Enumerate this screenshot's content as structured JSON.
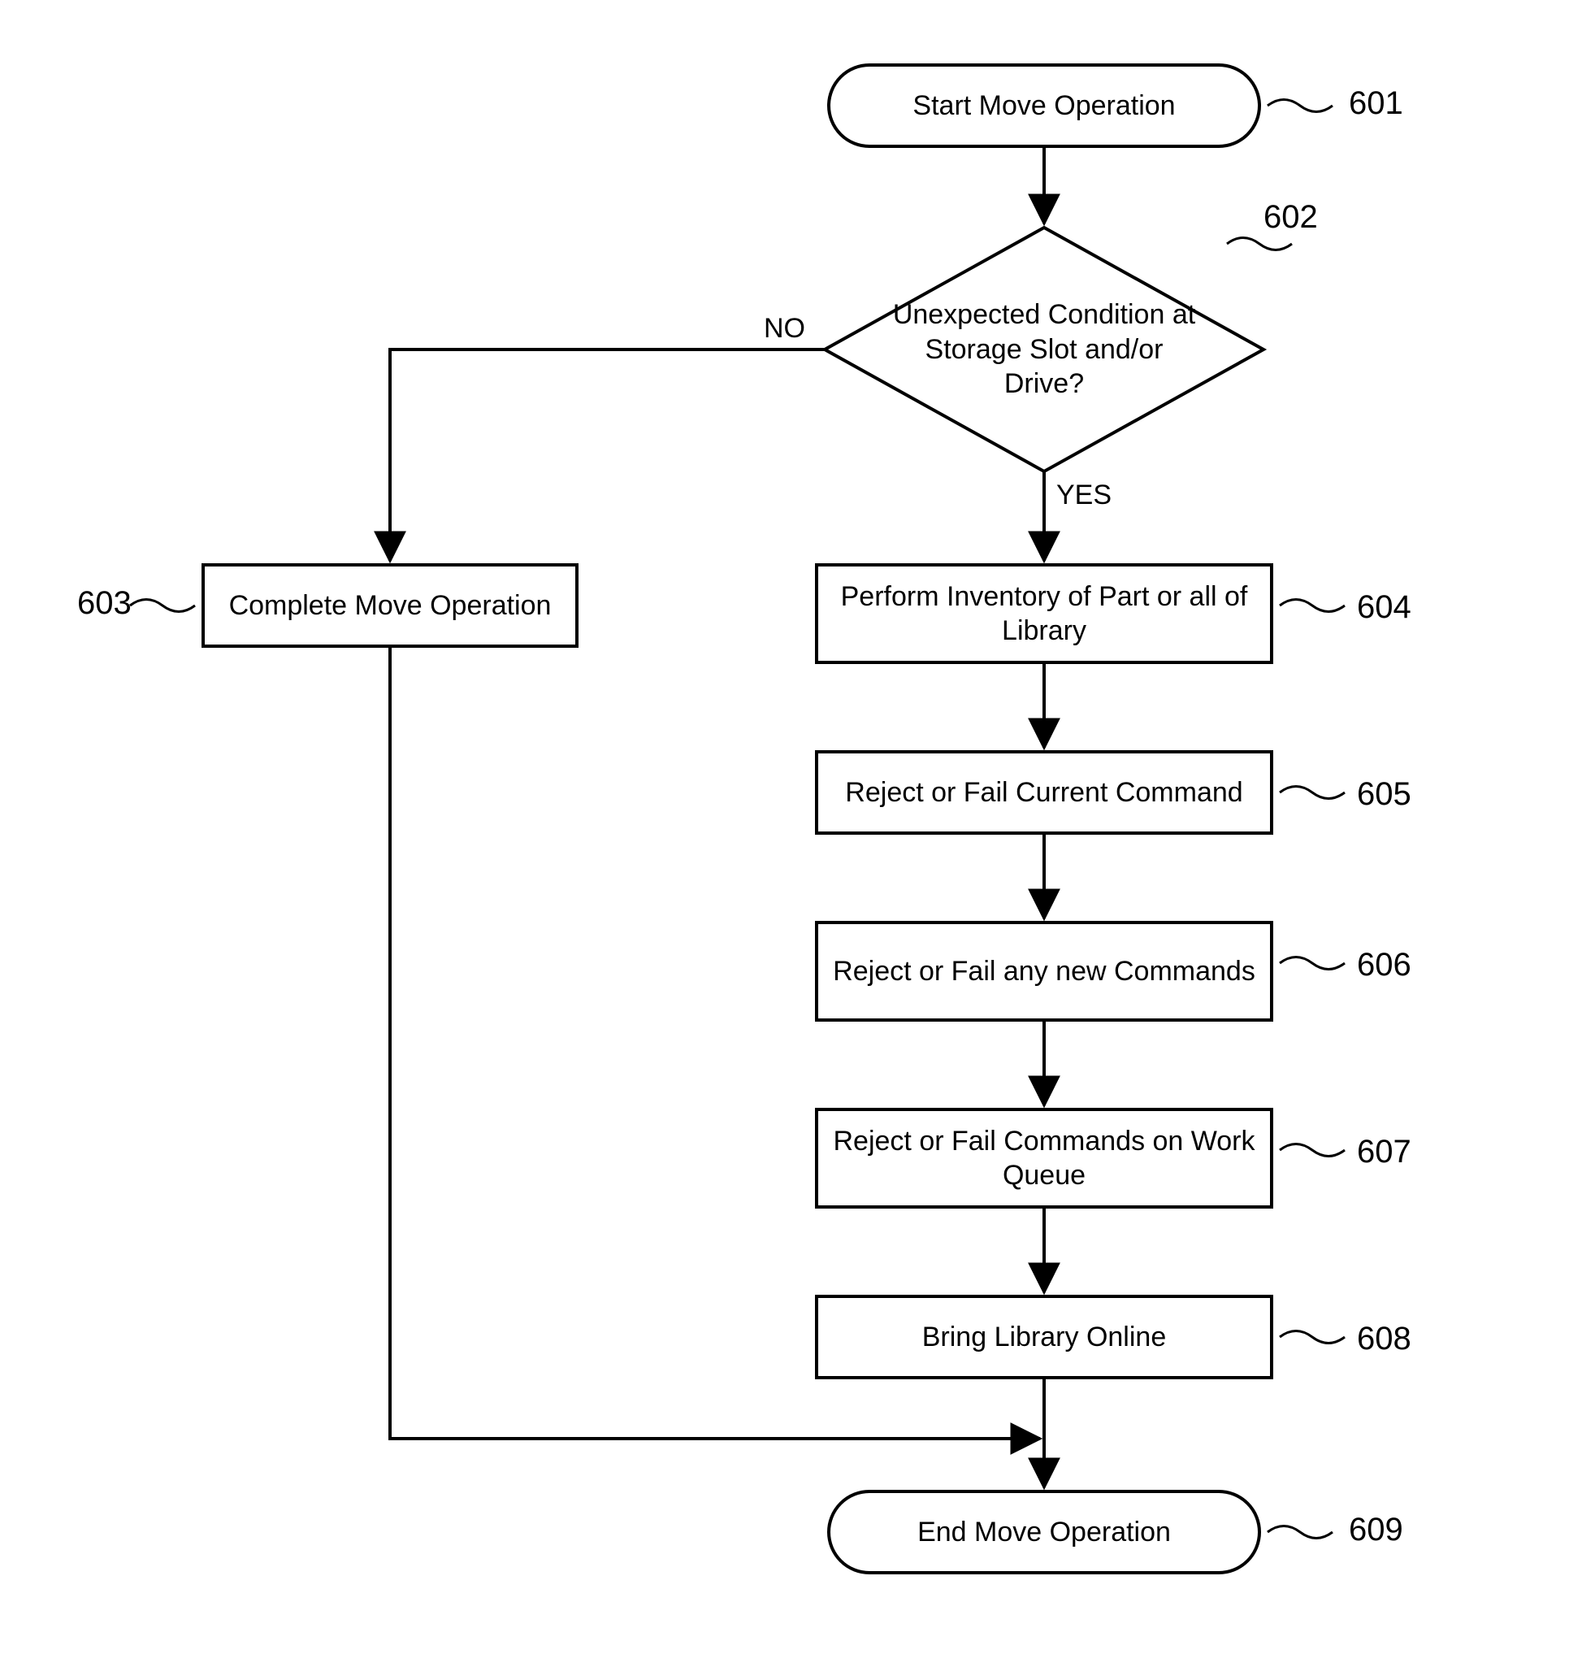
{
  "chart_data": {
    "type": "flowchart",
    "nodes": [
      {
        "id": "601",
        "kind": "terminator",
        "text": "Start Move Operation"
      },
      {
        "id": "602",
        "kind": "decision",
        "text": "Unexpected Condition at Storage Slot and/or Drive?"
      },
      {
        "id": "603",
        "kind": "process",
        "text": "Complete Move Operation"
      },
      {
        "id": "604",
        "kind": "process",
        "text": "Perform Inventory of Part or all of Library"
      },
      {
        "id": "605",
        "kind": "process",
        "text": "Reject or Fail Current Command"
      },
      {
        "id": "606",
        "kind": "process",
        "text": "Reject or Fail any new Commands"
      },
      {
        "id": "607",
        "kind": "process",
        "text": "Reject or Fail Commands on Work Queue"
      },
      {
        "id": "608",
        "kind": "process",
        "text": "Bring Library Online"
      },
      {
        "id": "609",
        "kind": "terminator",
        "text": "End Move Operation"
      }
    ],
    "edges": [
      {
        "from": "601",
        "to": "602",
        "label": ""
      },
      {
        "from": "602",
        "to": "603",
        "label": "NO"
      },
      {
        "from": "602",
        "to": "604",
        "label": "YES"
      },
      {
        "from": "604",
        "to": "605",
        "label": ""
      },
      {
        "from": "605",
        "to": "606",
        "label": ""
      },
      {
        "from": "606",
        "to": "607",
        "label": ""
      },
      {
        "from": "607",
        "to": "608",
        "label": ""
      },
      {
        "from": "608",
        "to": "609",
        "label": ""
      },
      {
        "from": "603",
        "to": "609",
        "label": ""
      }
    ]
  },
  "labels": {
    "n601": "Start Move Operation",
    "n602": "Unexpected Condition at Storage Slot and/or Drive?",
    "n603": "Complete Move Operation",
    "n604": "Perform Inventory of Part or all of Library",
    "n605": "Reject or Fail Current Command",
    "n606": "Reject or Fail any new Commands",
    "n607": "Reject or Fail Commands on Work Queue",
    "n608": "Bring Library Online",
    "n609": "End Move Operation",
    "edge_no": "NO",
    "edge_yes": "YES",
    "ref601": "601",
    "ref602": "602",
    "ref603": "603",
    "ref604": "604",
    "ref605": "605",
    "ref606": "606",
    "ref607": "607",
    "ref608": "608",
    "ref609": "609"
  }
}
